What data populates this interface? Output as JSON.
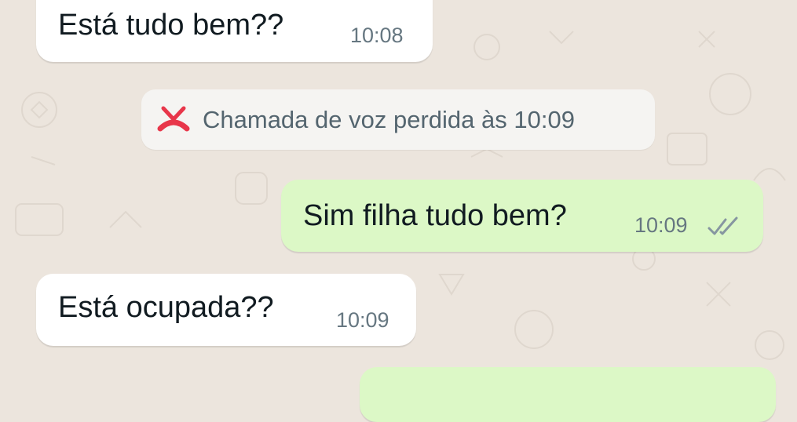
{
  "chat": {
    "messages": [
      {
        "direction": "incoming",
        "text": "Está tudo bem??",
        "time": "10:08"
      },
      {
        "direction": "incoming",
        "text": "Está ocupada??",
        "time": "10:09"
      }
    ],
    "outgoing": [
      {
        "direction": "outgoing",
        "text": "Sim filha tudo bem?",
        "time": "10:09",
        "status_icon": "double-check-icon"
      }
    ],
    "system_notice": {
      "icon": "missed-call-icon",
      "text": "Chamada de voz perdida às 10:09",
      "icon_color": "#e8364a"
    },
    "partial_message": {
      "direction": "outgoing",
      "text": ""
    }
  },
  "colors": {
    "incoming_bubble": "#ffffff",
    "outgoing_bubble": "#dcf8c6",
    "background": "#ece5dd"
  }
}
